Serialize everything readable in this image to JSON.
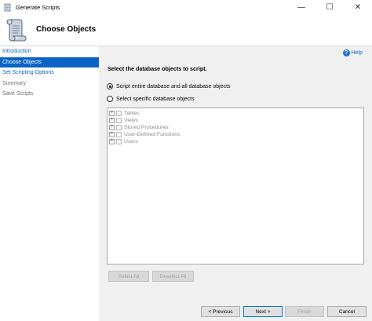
{
  "window": {
    "title": "Generate Scripts",
    "controls": {
      "minimize": "—",
      "maximize": "☐",
      "close": "✕"
    }
  },
  "header": {
    "title": "Choose Objects",
    "icon": "scroll-icon"
  },
  "sidebar": {
    "items": [
      {
        "label": "Introduction",
        "state": "link"
      },
      {
        "label": "Choose Objects",
        "state": "active"
      },
      {
        "label": "Set Scripting Options",
        "state": "link"
      },
      {
        "label": "Summary",
        "state": "disabled"
      },
      {
        "label": "Save Scripts",
        "state": "disabled"
      }
    ]
  },
  "main": {
    "help_label": "Help",
    "prompt": "Select the database objects to script.",
    "options": [
      {
        "label": "Script entire database and all database objects",
        "checked": true
      },
      {
        "label": "Select specific database objects",
        "checked": false
      }
    ],
    "tree_items": [
      "Tables",
      "Views",
      "Stored Procedures",
      "User-Defined Functions",
      "Users"
    ],
    "select_all_label": "Select All",
    "deselect_all_label": "Deselect All"
  },
  "footer": {
    "previous_label": "< Previous",
    "next_label": "Next >",
    "finish_label": "Finish",
    "cancel_label": "Cancel"
  },
  "colors": {
    "accent": "#0a64c6",
    "link": "#0b62c4",
    "content_bg": "#f0f0f0"
  }
}
